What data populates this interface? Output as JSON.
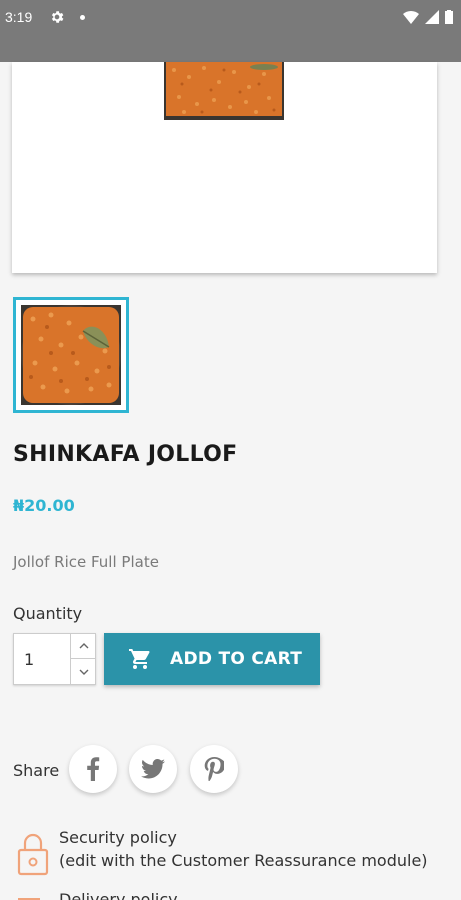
{
  "status_bar": {
    "time": "3:19"
  },
  "product": {
    "title": "SHINKAFA JOLLOF",
    "price": "₦20.00",
    "description": "Jollof Rice Full Plate"
  },
  "quantity": {
    "label": "Quantity",
    "value": "1"
  },
  "add_to_cart": {
    "label": "ADD TO CART"
  },
  "share": {
    "label": "Share"
  },
  "reassurance": {
    "security_title": "Security policy",
    "security_sub": "(edit with the Customer Reassurance module)",
    "next_title": "Delivery policy"
  },
  "colors": {
    "accent": "#2fb5d2",
    "button": "#2b93a9",
    "status_bar": "#7a7a7a"
  }
}
